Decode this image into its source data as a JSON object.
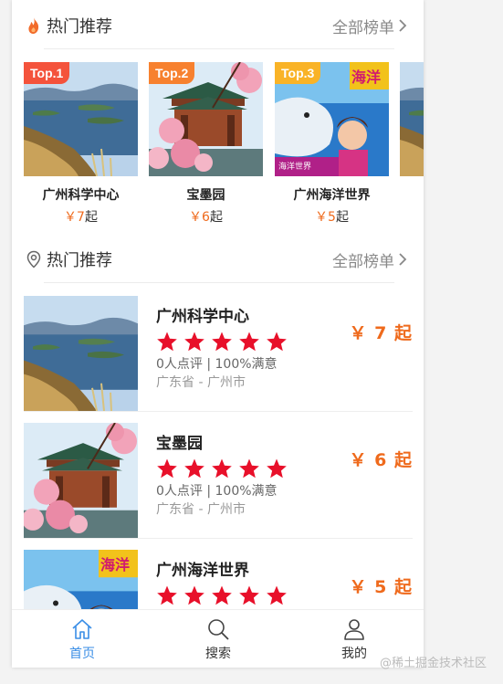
{
  "sections": [
    {
      "title": "热门推荐",
      "more_label": "全部榜单",
      "icon": "flame-icon"
    },
    {
      "title": "热门推荐",
      "more_label": "全部榜单",
      "icon": "location-pin-icon"
    }
  ],
  "top_list": [
    {
      "rank_label": "Top.1",
      "name": "广州科学中心",
      "currency": "￥",
      "price": "7",
      "suffix": "起",
      "badge_color": "#f4533c",
      "image": "lake-islands-photo"
    },
    {
      "rank_label": "Top.2",
      "name": "宝墨园",
      "currency": "￥",
      "price": "6",
      "suffix": "起",
      "badge_color": "#f7812f",
      "image": "pavilion-blossom-photo"
    },
    {
      "rank_label": "Top.3",
      "name": "广州海洋世界",
      "currency": "￥",
      "price": "5",
      "suffix": "起",
      "badge_color": "#f9b327",
      "image": "ocean-world-poster"
    }
  ],
  "attractions": [
    {
      "name": "广州科学中心",
      "rating": 5,
      "reviews": "0人点评 | 100%满意",
      "location": "广东省 - 广州市",
      "price": "￥ 7 起",
      "image": "lake-islands-photo"
    },
    {
      "name": "宝墨园",
      "rating": 5,
      "reviews": "0人点评 | 100%满意",
      "location": "广东省 - 广州市",
      "price": "￥ 6 起",
      "image": "pavilion-blossom-photo"
    },
    {
      "name": "广州海洋世界",
      "rating": 5,
      "reviews": "",
      "location": "",
      "price": "￥ 5 起",
      "image": "ocean-world-poster"
    }
  ],
  "tabbar": [
    {
      "label": "首页",
      "icon": "home-icon",
      "active": true
    },
    {
      "label": "搜索",
      "icon": "search-icon",
      "active": false
    },
    {
      "label": "我的",
      "icon": "user-icon",
      "active": false
    }
  ],
  "watermark": "@稀土掘金技术社区",
  "colors": {
    "accent": "#3a8ee6",
    "price": "#ef6a1c",
    "star": "#e8102a"
  }
}
